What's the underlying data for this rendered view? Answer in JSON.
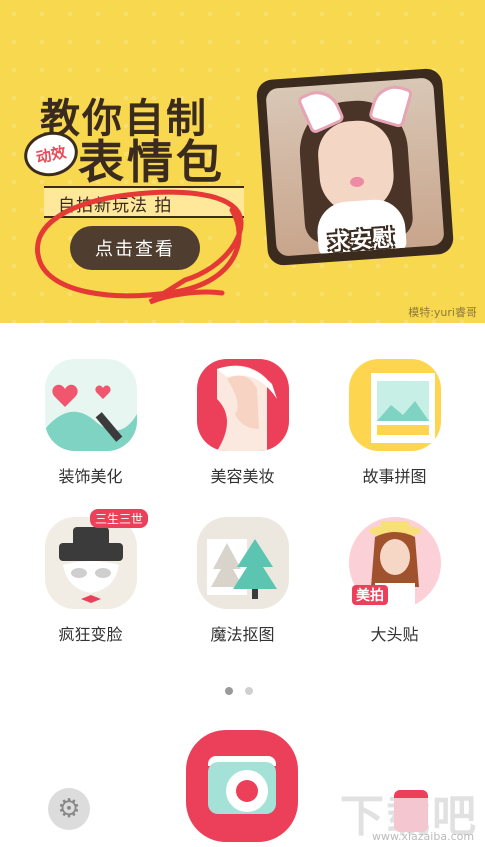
{
  "banner": {
    "title_line1": "教你自制",
    "tag": "动效",
    "title_line2": "表情包",
    "ribbon_text": "自拍新玩法 拍",
    "button_label": "点击查看",
    "photo_caption": "求安慰",
    "credit": "模特:yuri睿哥",
    "colors": {
      "background": "#f8d84f",
      "button": "#4f3e2f",
      "annotation_circle": "#e53935"
    }
  },
  "features": [
    {
      "label": "装饰美化",
      "icon": "decorate-icon"
    },
    {
      "label": "美容美妆",
      "icon": "makeup-icon"
    },
    {
      "label": "故事拼图",
      "icon": "collage-icon"
    },
    {
      "label": "疯狂变脸",
      "icon": "mask-icon",
      "badge": "三生三世"
    },
    {
      "label": "魔法抠图",
      "icon": "cutout-icon"
    },
    {
      "label": "大头贴",
      "icon": "photo-sticker-icon",
      "badge": "美拍"
    }
  ],
  "pager": {
    "pages": 2,
    "current": 1
  },
  "bottom": {
    "camera_icon": "camera-icon",
    "settings_icon": "gear-icon",
    "store_icon": "store-icon",
    "accent": "#ec3f59"
  },
  "watermark": {
    "text": "下载吧",
    "url": "www.xiazaiba.com"
  }
}
